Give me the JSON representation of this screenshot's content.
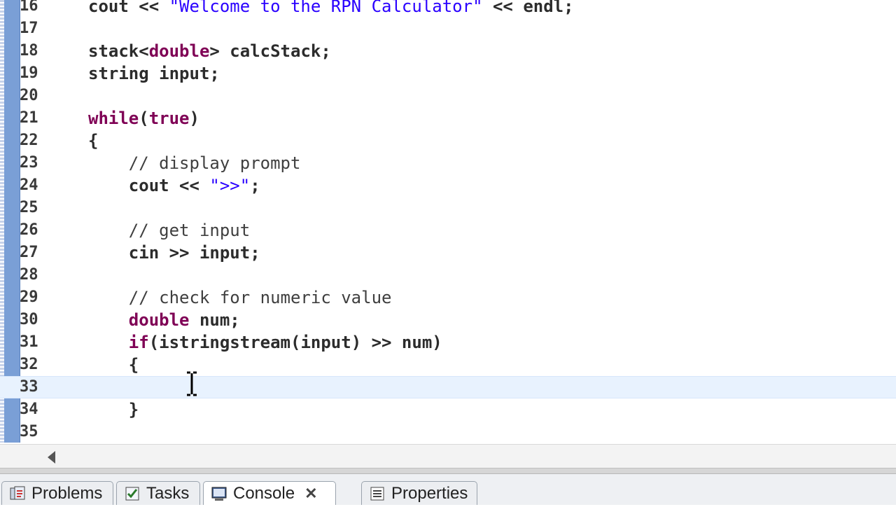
{
  "editor": {
    "current_line": "33",
    "lines": [
      {
        "n": "16",
        "parts": [
          [
            "",
            "cout << "
          ],
          [
            "str",
            "\"Welcome to the RPN Calculator\""
          ],
          [
            "",
            " << endl;"
          ]
        ]
      },
      {
        "n": "17",
        "parts": []
      },
      {
        "n": "18",
        "parts": [
          [
            "",
            "stack<"
          ],
          [
            "kw",
            "double"
          ],
          [
            "",
            "> calcStack;"
          ]
        ]
      },
      {
        "n": "19",
        "parts": [
          [
            "",
            "string input;"
          ]
        ]
      },
      {
        "n": "20",
        "parts": []
      },
      {
        "n": "21",
        "parts": [
          [
            "kw",
            "while"
          ],
          [
            "",
            "("
          ],
          [
            "kw",
            "true"
          ],
          [
            "",
            ")"
          ]
        ]
      },
      {
        "n": "22",
        "parts": [
          [
            "",
            "{"
          ]
        ]
      },
      {
        "n": "23",
        "parts": [
          [
            "cm",
            "    // display prompt"
          ]
        ]
      },
      {
        "n": "24",
        "parts": [
          [
            "",
            "    cout << "
          ],
          [
            "str",
            "\">>\""
          ],
          [
            "",
            ";"
          ]
        ]
      },
      {
        "n": "25",
        "parts": []
      },
      {
        "n": "26",
        "parts": [
          [
            "cm",
            "    // get input"
          ]
        ]
      },
      {
        "n": "27",
        "parts": [
          [
            "",
            "    cin >> input;"
          ]
        ]
      },
      {
        "n": "28",
        "parts": []
      },
      {
        "n": "29",
        "parts": [
          [
            "cm",
            "    // check for numeric value"
          ]
        ]
      },
      {
        "n": "30",
        "parts": [
          [
            "kw",
            "    double"
          ],
          [
            "",
            " num;"
          ]
        ]
      },
      {
        "n": "31",
        "parts": [
          [
            "kw",
            "    if"
          ],
          [
            "",
            "(istringstream(input) >> num)"
          ]
        ]
      },
      {
        "n": "32",
        "parts": [
          [
            "",
            "    {"
          ]
        ]
      },
      {
        "n": "33",
        "parts": []
      },
      {
        "n": "34",
        "parts": [
          [
            "",
            "    }"
          ]
        ]
      },
      {
        "n": "35",
        "parts": []
      }
    ]
  },
  "tabs": [
    {
      "label": "Problems",
      "icon": "problems-icon"
    },
    {
      "label": "Tasks",
      "icon": "tasks-icon"
    },
    {
      "label": "Console",
      "icon": "console-icon",
      "active": true,
      "close": "✕"
    },
    {
      "label": "Properties",
      "icon": "properties-icon"
    }
  ],
  "colors": {
    "keyword": "#7f0055",
    "string": "#2a00ff",
    "gutter": "#7a9fd6",
    "current_line": "#e8f2fe"
  }
}
